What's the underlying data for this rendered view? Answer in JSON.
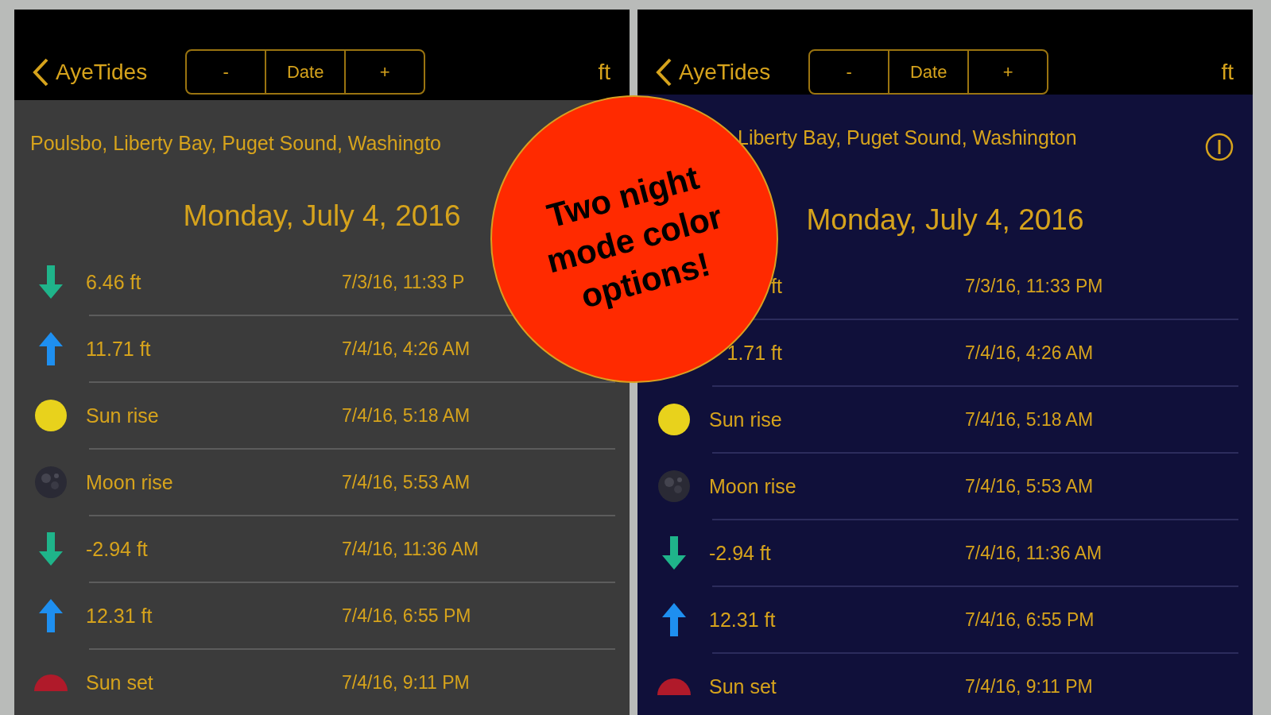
{
  "panels": [
    {
      "kind": "grey",
      "nav": {
        "back": "AyeTides",
        "segments": [
          "-",
          "Date",
          "+"
        ],
        "unit": "ft"
      },
      "location": {
        "text": "Poulsbo, Liberty Bay, Puget Sound, Washingto",
        "covered": false
      },
      "info_button": false,
      "date": "Monday, July 4, 2016",
      "events": [
        {
          "kind": "down",
          "value": "6.46 ft",
          "time": "7/3/16, 11:33 P",
          "partial": false
        },
        {
          "kind": "up",
          "value": "11.71 ft",
          "time": "7/4/16, 4:26 AM",
          "partial": false
        },
        {
          "kind": "sun",
          "value": "Sun rise",
          "time": "7/4/16, 5:18 AM",
          "partial": false
        },
        {
          "kind": "moon",
          "value": "Moon rise",
          "time": "7/4/16, 5:53 AM",
          "partial": false
        },
        {
          "kind": "down",
          "value": "-2.94 ft",
          "time": "7/4/16, 11:36 AM",
          "partial": false
        },
        {
          "kind": "up",
          "value": "12.31 ft",
          "time": "7/4/16, 6:55 PM",
          "partial": false
        },
        {
          "kind": "sunset",
          "value": "Sun set",
          "time": "7/4/16, 9:11 PM",
          "partial": false
        }
      ]
    },
    {
      "kind": "navy",
      "nav": {
        "back": "AyeTides",
        "segments": [
          "-",
          "Date",
          "+"
        ],
        "unit": "ft"
      },
      "location": {
        "text": "Liberty Bay, Puget Sound, Washington",
        "covered": true
      },
      "info_button": true,
      "date": "Monday, July 4, 2016",
      "events": [
        {
          "kind": "hidden",
          "value": "ft",
          "time": "7/3/16, 11:33 PM",
          "partial": true
        },
        {
          "kind": "hidden",
          "value": "1.71 ft",
          "time": "7/4/16, 4:26 AM",
          "partial": true
        },
        {
          "kind": "sun",
          "value": "Sun rise",
          "time": "7/4/16, 5:18 AM",
          "partial": false
        },
        {
          "kind": "moon",
          "value": "Moon rise",
          "time": "7/4/16, 5:53 AM",
          "partial": false
        },
        {
          "kind": "down",
          "value": "-2.94 ft",
          "time": "7/4/16, 11:36 AM",
          "partial": false
        },
        {
          "kind": "up",
          "value": "12.31 ft",
          "time": "7/4/16, 6:55 PM",
          "partial": false
        },
        {
          "kind": "sunset",
          "value": "Sun set",
          "time": "7/4/16, 9:11 PM",
          "partial": false
        }
      ]
    }
  ],
  "badge": "Two night\nmode color\noptions!"
}
